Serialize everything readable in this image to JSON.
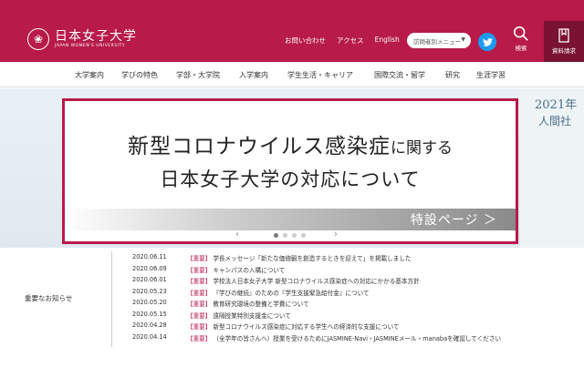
{
  "header": {
    "logo": {
      "name_jp": "日本女子大学",
      "name_en": "JAPAN WOMEN'S UNIVERSITY"
    },
    "util_links": [
      "お問い合わせ",
      "アクセス",
      "English"
    ],
    "visitor_select": {
      "value": "訪問者別メニュー"
    },
    "search_label": "検索",
    "request_label": "資料請求",
    "colors": {
      "brand": "#b81a4a",
      "brand_dark": "#7a1233",
      "twitter": "#1d9bf0"
    }
  },
  "nav": {
    "items": [
      "大学案内",
      "学びの特色",
      "学部・大学院",
      "入学案内",
      "学生生活・キャリア",
      "国際交流・留学",
      "研究",
      "生涯学習"
    ]
  },
  "hero": {
    "bg_year": "2021年",
    "bg_sub": "人間社",
    "banner": {
      "line1_main": "新型コロナウイルス感染症",
      "line1_rest": "に関する",
      "line2": "日本女子大学の対応について",
      "link": "特設ページ ＞"
    }
  },
  "news": {
    "heading": "重要なお知らせ",
    "items": [
      {
        "date": "2020.06.11",
        "tag": "【重要】",
        "title": "学長メッセージ「新たな価値観を創造するときを迎えて」を掲載しました"
      },
      {
        "date": "2020.06.09",
        "tag": "【重要】",
        "title": "キャンパスの入構について"
      },
      {
        "date": "2020.06.01",
        "tag": "【重要】",
        "title": "学校法人日本女子大学 新型コロナウイルス感染症への対応にかかる基本方針"
      },
      {
        "date": "2020.05.23",
        "tag": "【重要】",
        "title": "『学びの継続』のための『学生支援緊急給付金』について"
      },
      {
        "date": "2020.05.20",
        "tag": "【重要】",
        "title": "教育研究環境の整備と学費について"
      },
      {
        "date": "2020.05.15",
        "tag": "【重要】",
        "title": "遠隔授業特別支援金について"
      },
      {
        "date": "2020.04.28",
        "tag": "【重要】",
        "title": "新型コロナウイルス感染症に対応する学生への経済的な支援について"
      },
      {
        "date": "2020.04.14",
        "tag": "【重要】",
        "title": "（全学年の皆さんへ）授業を受けるためにJASMINE-Navi・JASMINEメール・manabaを確認してください"
      }
    ]
  }
}
